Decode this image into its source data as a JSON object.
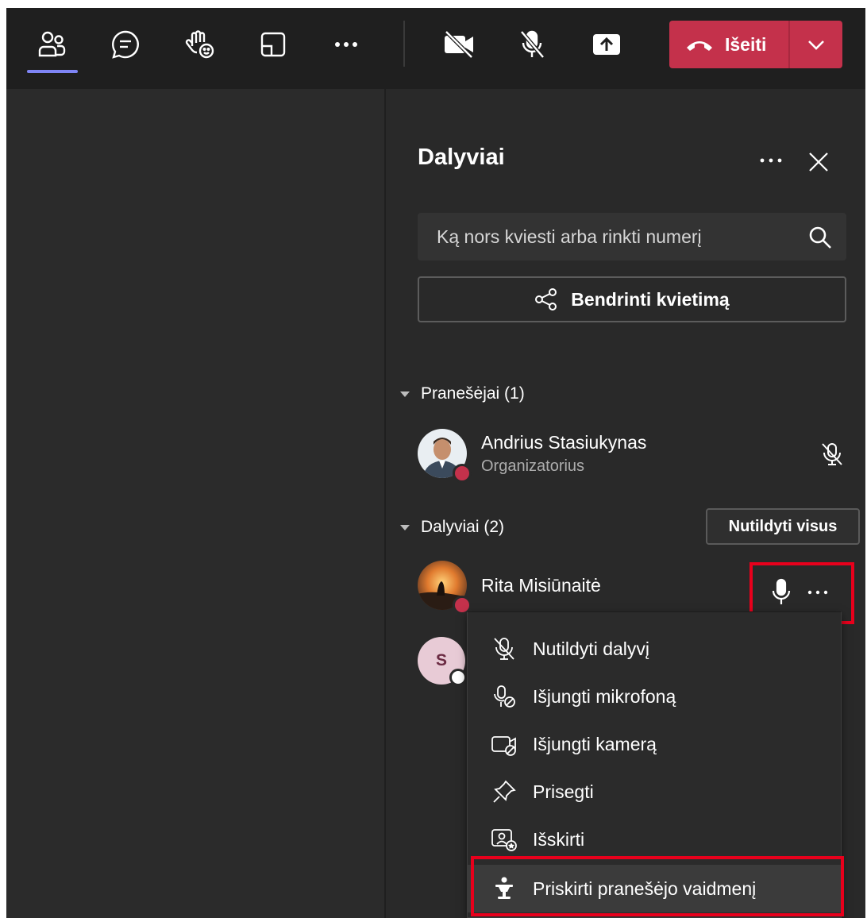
{
  "toolbar": {
    "icons": [
      "people-icon",
      "chat-icon",
      "raise-hand-icon",
      "rooms-icon",
      "more-icon",
      "camera-off-icon",
      "mic-off-icon",
      "share-screen-icon"
    ],
    "leave_label": "Išeiti",
    "leave_color": "#c4314b",
    "active_indicator_color": "#7f85f5"
  },
  "panel": {
    "title": "Dalyviai",
    "search_placeholder": "Ką nors kviesti arba rinkti numerį",
    "share_label": "Bendrinti kvietimą",
    "presenters_header": "Pranešėjai (1)",
    "presenters": [
      {
        "name": "Andrius Stasiukynas",
        "role": "Organizatorius"
      }
    ],
    "attendees_header": "Dalyviai (2)",
    "mute_all_label": "Nutildyti visus",
    "attendees": [
      {
        "name": "Rita Misiūnaitė"
      },
      {
        "initial": "S"
      }
    ]
  },
  "context_menu": {
    "items": [
      {
        "label": "Nutildyti dalyvį",
        "icon": "mic-off-icon"
      },
      {
        "label": "Išjungti mikrofoną",
        "icon": "disable-mic-icon"
      },
      {
        "label": "Išjungti kamerą",
        "icon": "disable-camera-icon"
      },
      {
        "label": "Prisegti",
        "icon": "pin-icon"
      },
      {
        "label": "Išskirti",
        "icon": "spotlight-icon"
      },
      {
        "label": "Priskirti pranešėjo vaidmenį",
        "icon": "make-presenter-icon"
      }
    ]
  },
  "highlight_color": "#e8001c"
}
